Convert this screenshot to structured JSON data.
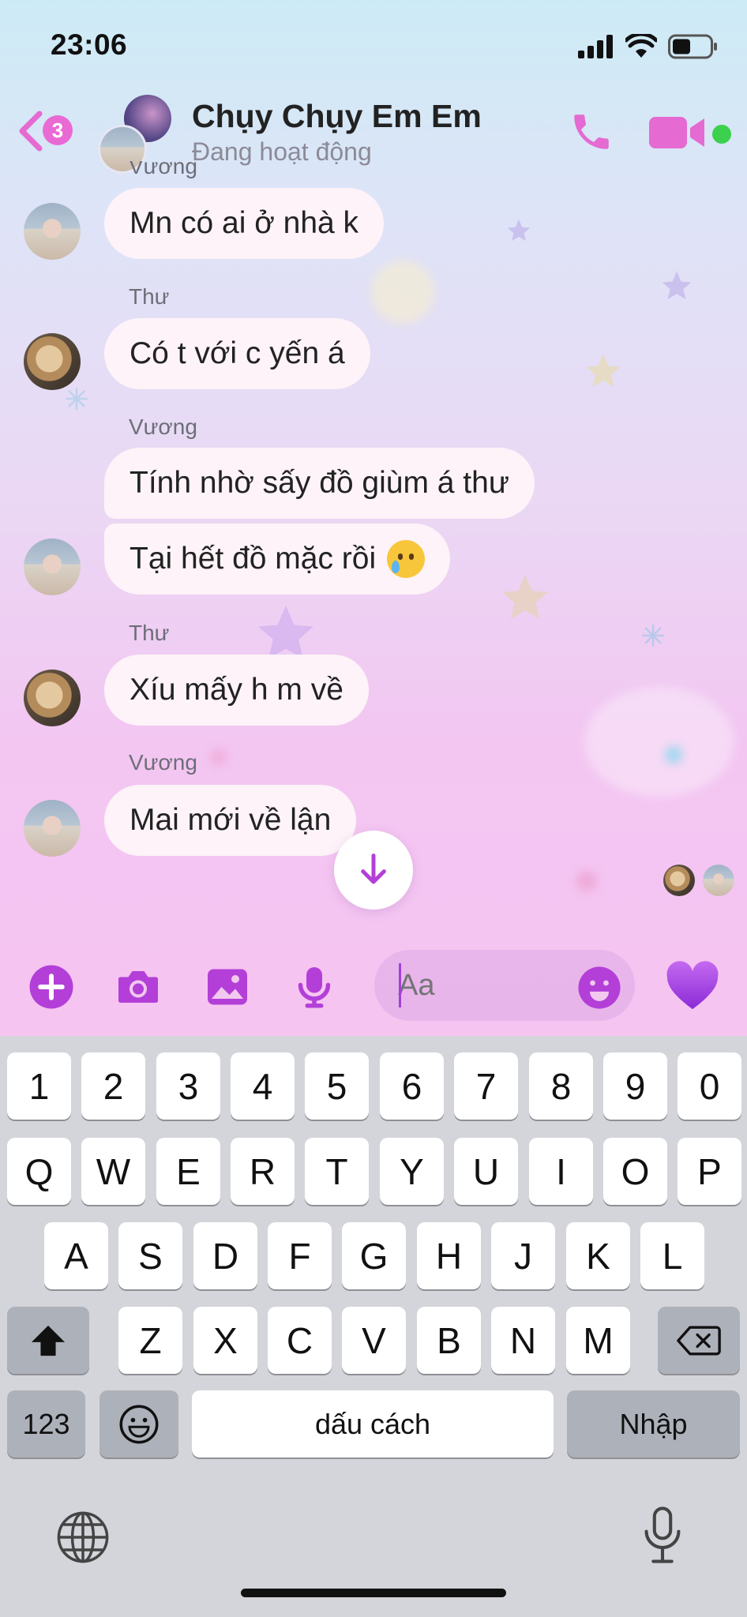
{
  "status_bar": {
    "time": "23:06"
  },
  "header": {
    "back_badge": "3",
    "title": "Chụy Chụy Em Em",
    "subtitle": "Đang hoạt động"
  },
  "messages": [
    {
      "sender": "",
      "text": "Mn có ai ở nhà k"
    },
    {
      "sender": "Thư",
      "text": "Có t với c yến á"
    },
    {
      "sender": "Vương",
      "text": "Tính nhờ sấy đồ giùm á thư"
    },
    {
      "sender": "",
      "text": "Tại hết đồ mặc rồi"
    },
    {
      "sender": "Thư",
      "text": "Xíu mấy h m về"
    },
    {
      "sender": "Vương",
      "text": "Mai mới về lận"
    }
  ],
  "top_partial_sender": "Vương",
  "composer": {
    "placeholder": "Aa"
  },
  "keyboard": {
    "row_numbers": [
      "1",
      "2",
      "3",
      "4",
      "5",
      "6",
      "7",
      "8",
      "9",
      "0"
    ],
    "row_q": [
      "Q",
      "W",
      "E",
      "R",
      "T",
      "Y",
      "U",
      "I",
      "O",
      "P"
    ],
    "row_a": [
      "A",
      "S",
      "D",
      "F",
      "G",
      "H",
      "J",
      "K",
      "L"
    ],
    "row_z": [
      "Z",
      "X",
      "C",
      "V",
      "B",
      "N",
      "M"
    ],
    "numbers_label": "123",
    "space_label": "dấu cách",
    "return_label": "Nhập"
  },
  "colors": {
    "accent": "#b33fd8",
    "header_icon": "#e56ad2",
    "online": "#3bd14e",
    "bubble": "#fdf3f8"
  },
  "icons": [
    "back-chevron-icon",
    "phone-icon",
    "video-camera-icon",
    "arrow-down-icon",
    "plus-icon",
    "camera-icon",
    "image-icon",
    "microphone-icon",
    "emoji-icon",
    "heart-icon",
    "shift-icon",
    "backspace-icon",
    "globe-icon",
    "dictation-icon"
  ]
}
